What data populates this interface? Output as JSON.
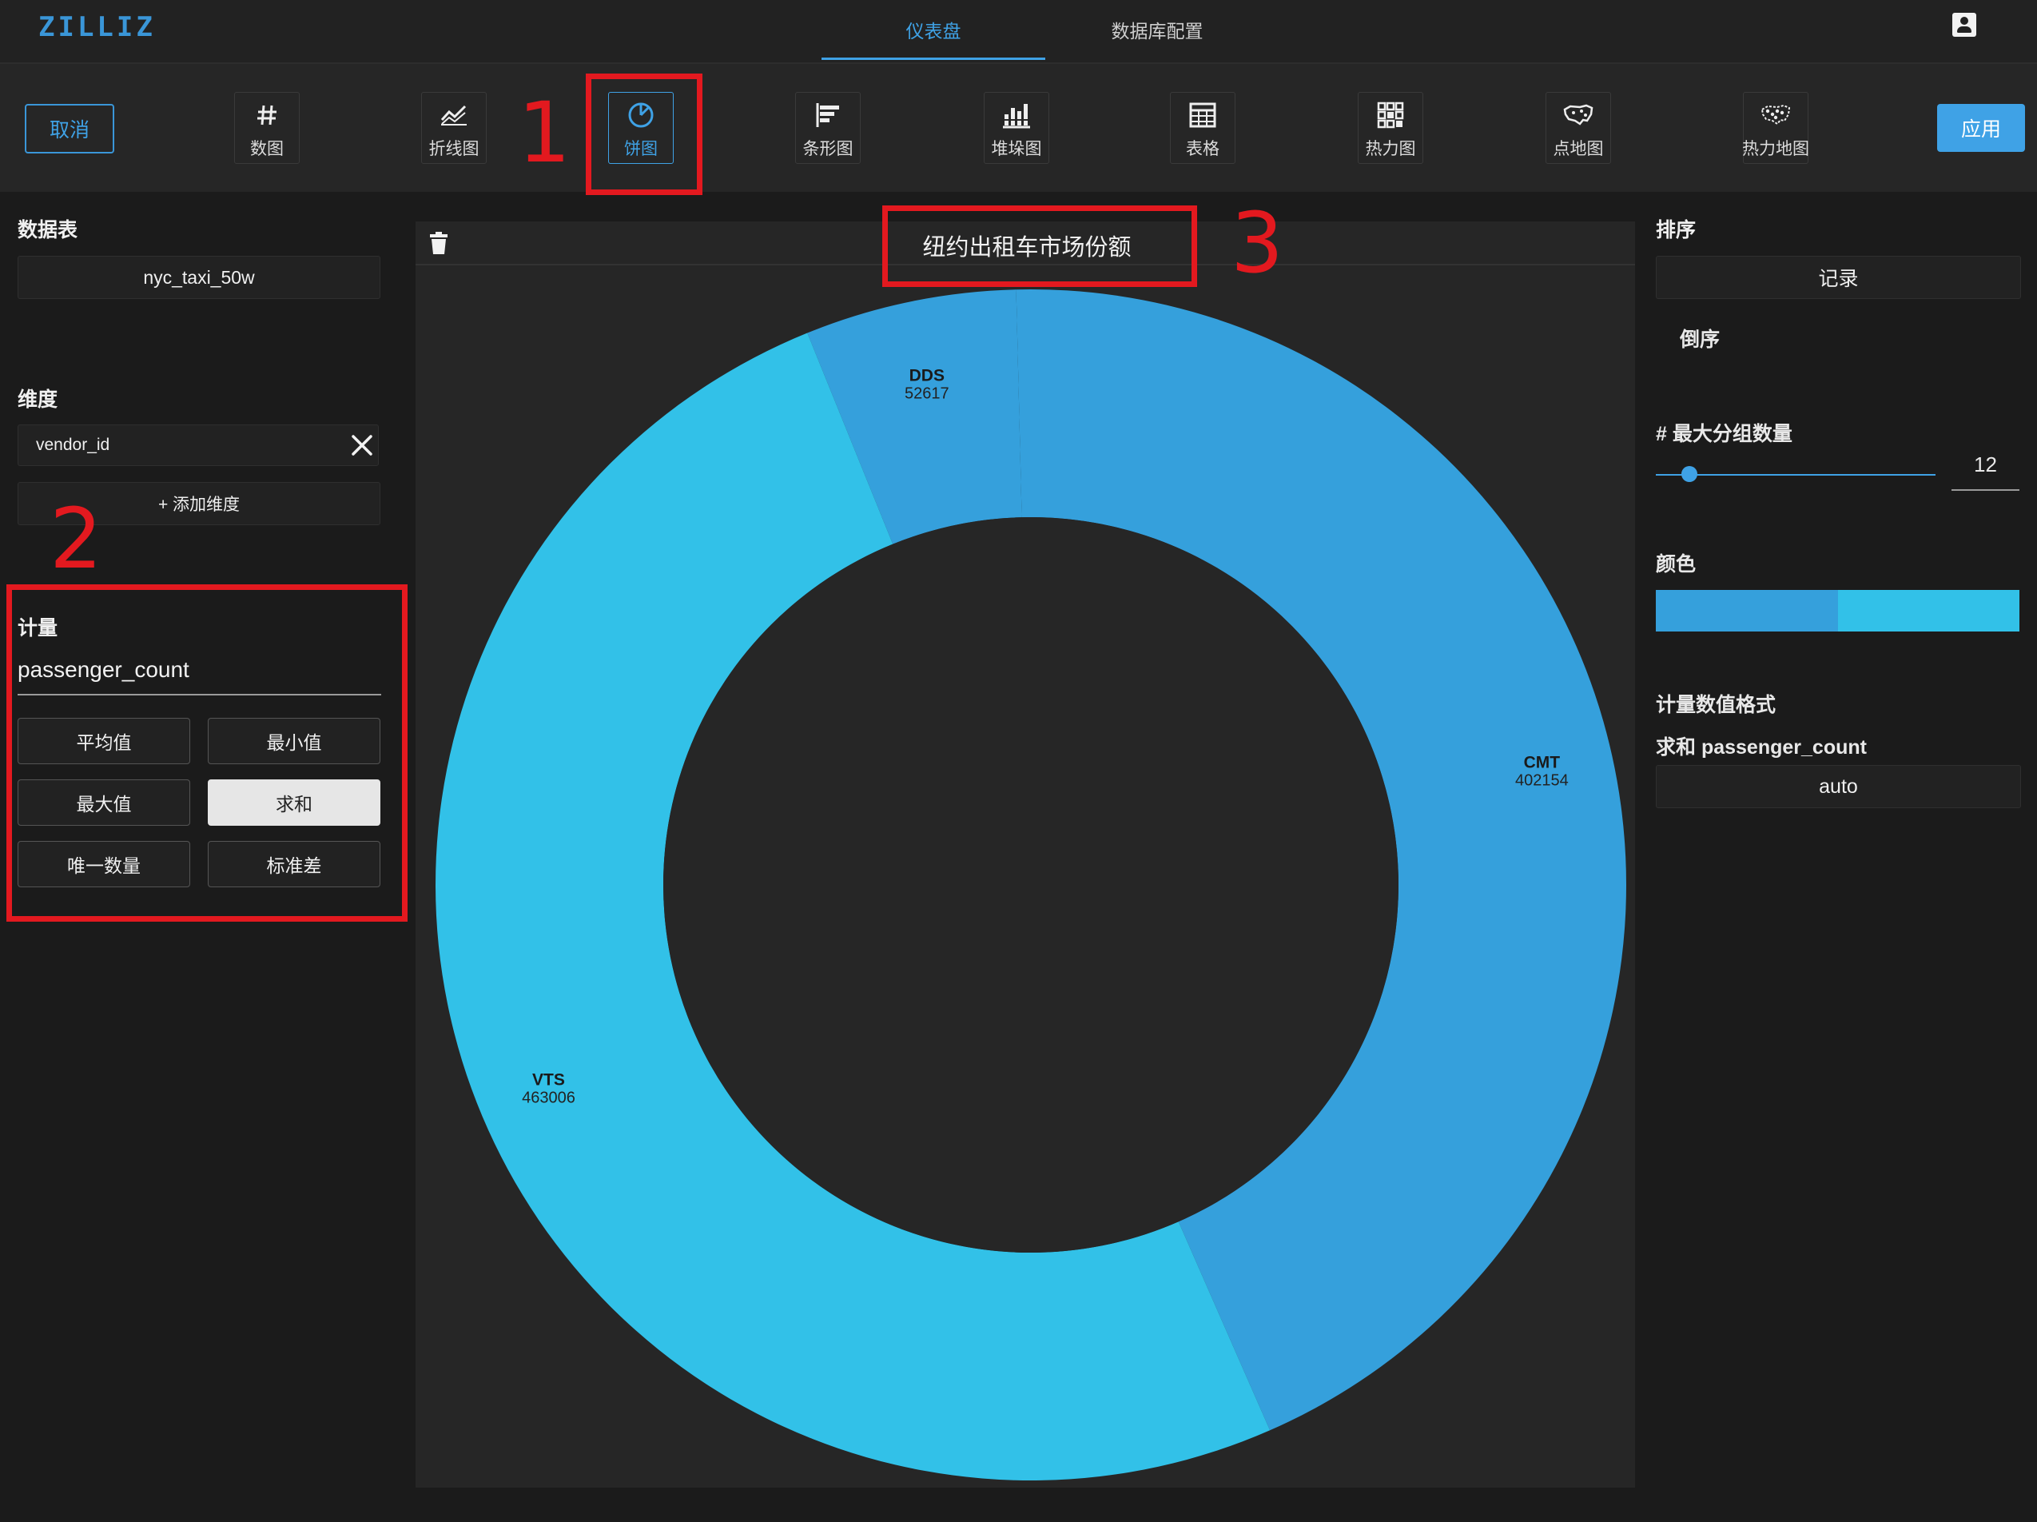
{
  "header": {
    "logo": "ZILLIZ",
    "tabs": [
      {
        "label": "仪表盘",
        "active": true
      },
      {
        "label": "数据库配置",
        "active": false
      }
    ],
    "user_icon": "account-box-icon"
  },
  "toolbar": {
    "cancel_label": "取消",
    "apply_label": "应用",
    "chart_types": [
      {
        "label": "数图",
        "icon": "hash-icon"
      },
      {
        "label": "折线图",
        "icon": "line-chart-icon"
      },
      {
        "label": "饼图",
        "icon": "pie-chart-icon",
        "active": true
      },
      {
        "label": "条形图",
        "icon": "bar-chart-icon"
      },
      {
        "label": "堆垛图",
        "icon": "stacked-chart-icon"
      },
      {
        "label": "表格",
        "icon": "table-icon"
      },
      {
        "label": "热力图",
        "icon": "heatmap-icon"
      },
      {
        "label": "点地图",
        "icon": "point-map-icon"
      },
      {
        "label": "热力地图",
        "icon": "heat-map-icon"
      }
    ]
  },
  "annotations": [
    "1",
    "2",
    "3"
  ],
  "left_panel": {
    "data_table_label": "数据表",
    "data_table_value": "nyc_taxi_50w",
    "dimension_label": "维度",
    "dimension_value": "vendor_id",
    "add_dimension_label": "+ 添加维度",
    "measure_label": "计量",
    "measure_value": "passenger_count",
    "aggregations": [
      {
        "label": "平均值",
        "selected": false
      },
      {
        "label": "最小值",
        "selected": false
      },
      {
        "label": "最大值",
        "selected": false
      },
      {
        "label": "求和",
        "selected": true
      },
      {
        "label": "唯一数量",
        "selected": false
      },
      {
        "label": "标准差",
        "selected": false
      }
    ]
  },
  "chart": {
    "title": "纽约出租车市场份额"
  },
  "chart_data": {
    "type": "pie",
    "donut": true,
    "title": "纽约出租车市场份额",
    "slices": [
      {
        "label": "DDS",
        "value": 52617,
        "color": "#35a0dc"
      },
      {
        "label": "CMT",
        "value": 402154,
        "color": "#35a0dc"
      },
      {
        "label": "VTS",
        "value": 463006,
        "color": "#32c1e8"
      }
    ]
  },
  "right_panel": {
    "sort_label": "排序",
    "sort_value": "记录",
    "desc_label": "倒序",
    "max_group_label": "# 最大分组数量",
    "max_group_value": "12",
    "max_group_slider": 0.12,
    "color_label": "颜色",
    "colors": [
      "#35a0dc",
      "#32c1e8"
    ],
    "format_label": "计量数值格式",
    "format_measure": "求和 passenger_count",
    "format_value": "auto"
  }
}
